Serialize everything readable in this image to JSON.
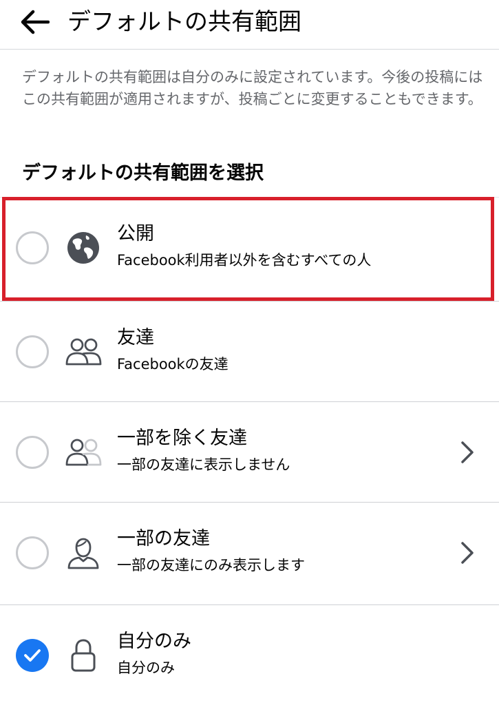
{
  "header": {
    "title": "デフォルトの共有範囲",
    "back_icon": "arrow-left-icon"
  },
  "description": "デフォルトの共有範囲は自分のみに設定されています。今後の投稿にはこの共有範囲が適用されますが、投稿ごとに変更することもできます。",
  "section_title": "デフォルトの共有範囲を選択",
  "options": [
    {
      "label": "公開",
      "sub": "Facebook利用者以外を含むすべての人",
      "icon": "globe-icon",
      "selected": false,
      "has_chevron": false
    },
    {
      "label": "友達",
      "sub": "Facebookの友達",
      "icon": "friends-icon",
      "selected": false,
      "has_chevron": false
    },
    {
      "label": "一部を除く友達",
      "sub": "一部の友達に表示しません",
      "icon": "friends-except-icon",
      "selected": false,
      "has_chevron": true
    },
    {
      "label": "一部の友達",
      "sub": "一部の友達にのみ表示します",
      "icon": "specific-friends-icon",
      "selected": false,
      "has_chevron": true
    },
    {
      "label": "自分のみ",
      "sub": "自分のみ",
      "icon": "lock-icon",
      "selected": true,
      "has_chevron": false
    }
  ],
  "colors": {
    "accent": "#1877f2",
    "highlight": "#d8202b",
    "secondary_text": "#65676b"
  }
}
